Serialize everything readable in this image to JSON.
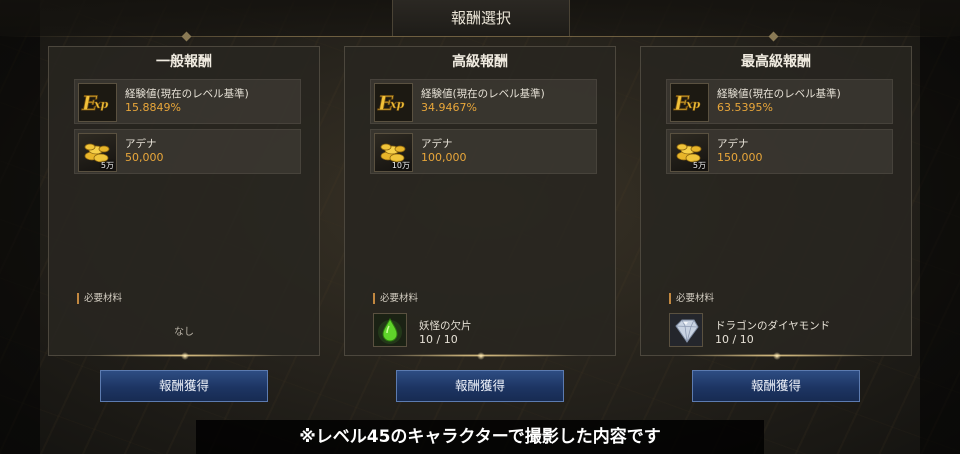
{
  "title": "報酬選択",
  "panels": [
    {
      "title": "一般報酬",
      "exp": {
        "name": "経験値(現在のレベル基準)",
        "value": "15.8849%"
      },
      "adena": {
        "name": "アデナ",
        "value": "50,000",
        "badge": "5万"
      },
      "required_label": "必要材料",
      "required_none": "なし",
      "button": "報酬獲得"
    },
    {
      "title": "高級報酬",
      "exp": {
        "name": "経験値(現在のレベル基準)",
        "value": "34.9467%"
      },
      "adena": {
        "name": "アデナ",
        "value": "100,000",
        "badge": "10万"
      },
      "required_label": "必要材料",
      "material": {
        "name": "妖怪の欠片",
        "count": "10 / 10",
        "icon": "green-droplet-icon"
      },
      "button": "報酬獲得"
    },
    {
      "title": "最高級報酬",
      "exp": {
        "name": "経験値(現在のレベル基準)",
        "value": "63.5395%"
      },
      "adena": {
        "name": "アデナ",
        "value": "150,000",
        "badge": "5万"
      },
      "required_label": "必要材料",
      "material": {
        "name": "ドラゴンのダイヤモンド",
        "count": "10 / 10",
        "icon": "diamond-icon"
      },
      "button": "報酬獲得"
    }
  ],
  "caption": "※レベル45のキャラクターで撮影した内容です",
  "colors": {
    "value_orange": "#e8a63a",
    "button_blue": "#1d3563",
    "panel_bg": "#28251f"
  }
}
